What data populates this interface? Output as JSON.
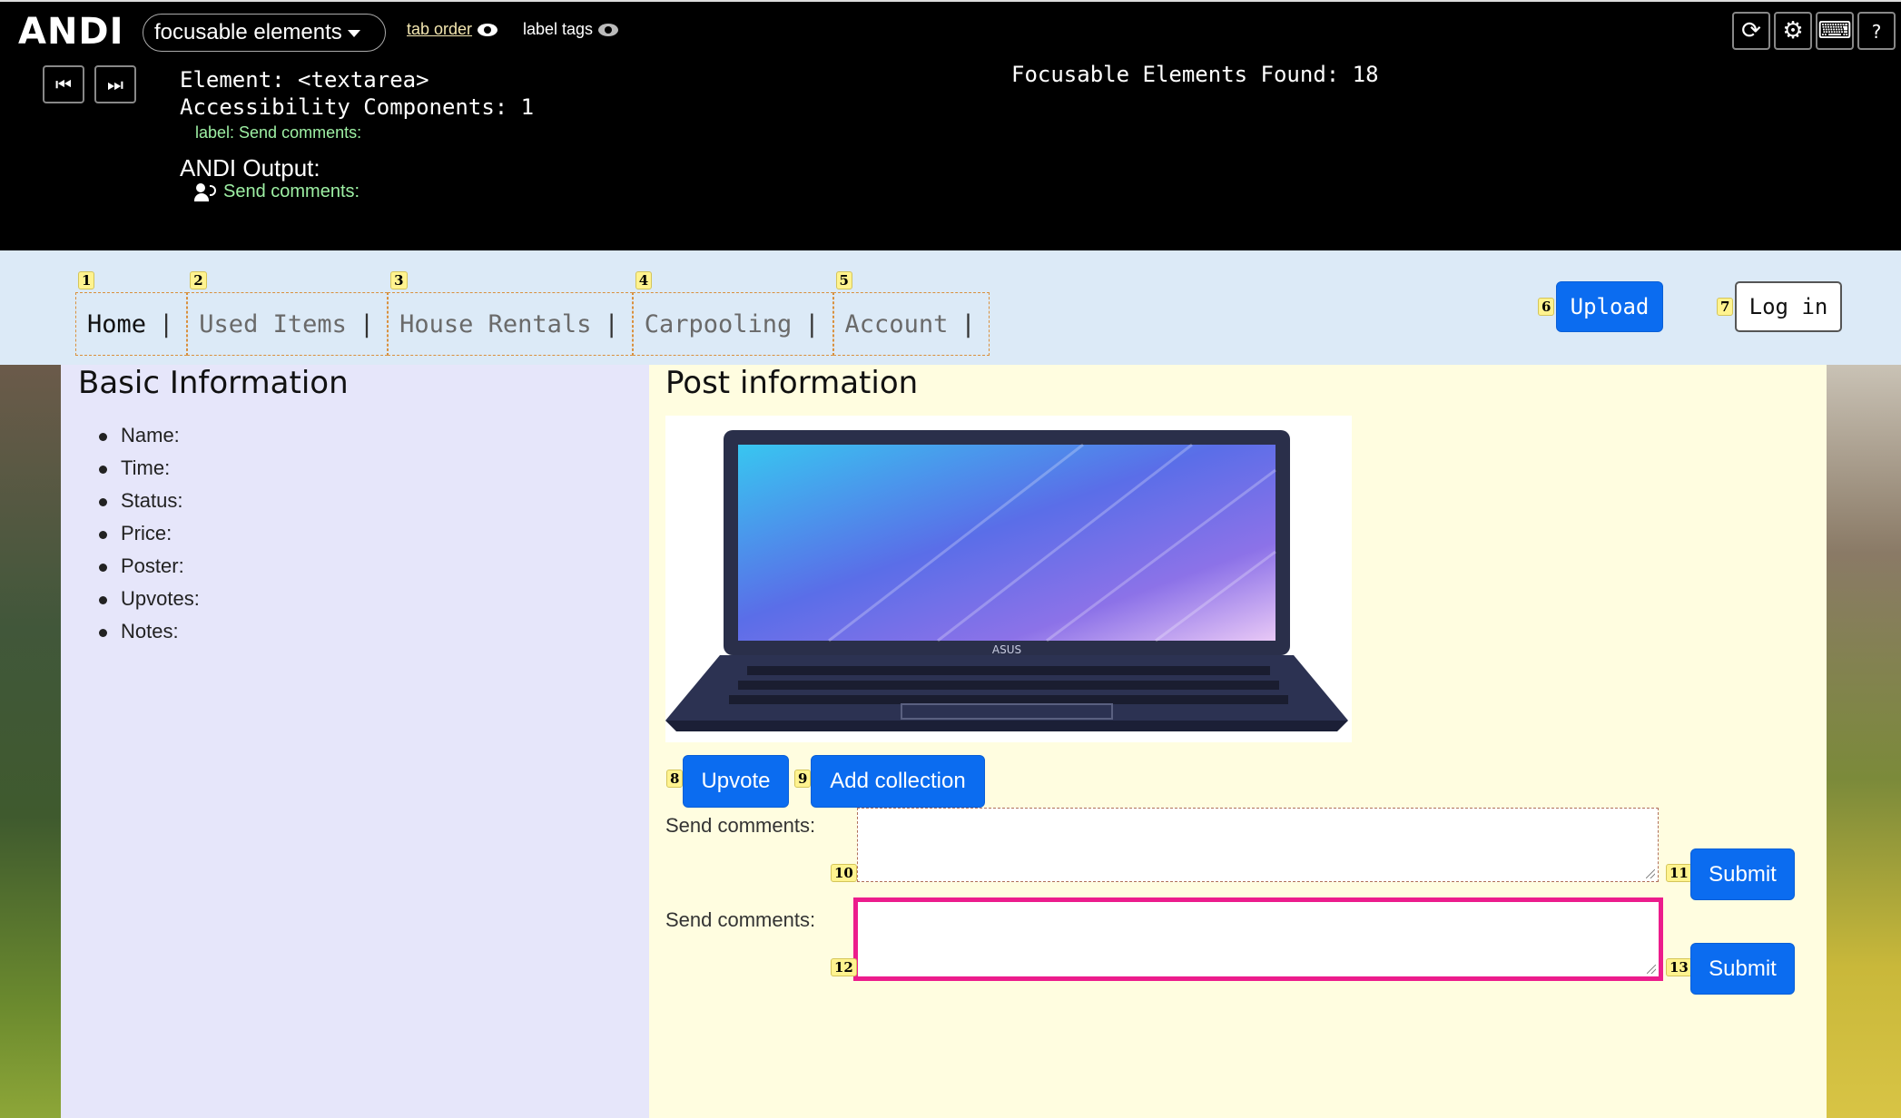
{
  "andi": {
    "logo": "ANDI",
    "module": "focusable elements",
    "tab_order_label": "tab order",
    "label_tags_label": "label tags",
    "element_line": "Element: <textarea>",
    "components_line": "Accessibility Components: 1",
    "label_line": "label: Send comments:",
    "output_title": "ANDI Output:",
    "output_text": "Send comments:",
    "found_line": "Focusable Elements Found: 18",
    "buttons": {
      "prev": "⏮",
      "next": "⏭",
      "refresh": "⟳",
      "settings": "⚙",
      "keyboard": "⌨",
      "help": "?"
    }
  },
  "site": {
    "menu": [
      {
        "badge": "1",
        "label": "Home"
      },
      {
        "badge": "2",
        "label": "Used Items"
      },
      {
        "badge": "3",
        "label": "House Rentals"
      },
      {
        "badge": "4",
        "label": "Carpooling"
      },
      {
        "badge": "5",
        "label": "Account"
      }
    ],
    "menu_separator": "|",
    "upload": {
      "badge": "6",
      "label": "Upload"
    },
    "login": {
      "badge": "7",
      "label": "Log in"
    },
    "basic_info": {
      "title": "Basic Information",
      "items": [
        "Name:",
        "Time:",
        "Status:",
        "Price:",
        "Poster:",
        "Upvotes:",
        "Notes:"
      ]
    },
    "post": {
      "title": "Post information",
      "laptop_brand": "ASUS",
      "upvote": {
        "badge": "8",
        "label": "Upvote"
      },
      "add_collection": {
        "badge": "9",
        "label": "Add collection"
      },
      "comments": [
        {
          "label": "Send comments:",
          "textarea_badge": "10",
          "submit_badge": "11",
          "submit": "Submit"
        },
        {
          "label": "Send comments:",
          "textarea_badge": "12",
          "submit_badge": "13",
          "submit": "Submit"
        }
      ]
    }
  },
  "colors": {
    "andi_bg": "#000000",
    "andi_label_green": "#9ef0a4",
    "nav_bg": "#dceaf7",
    "left_panel_bg": "#e6e6fa",
    "right_panel_bg": "#fffde0",
    "button_blue": "#0b6cf0",
    "focus_pink": "#ec1c8c",
    "badge_yellow": "#fff38f"
  }
}
